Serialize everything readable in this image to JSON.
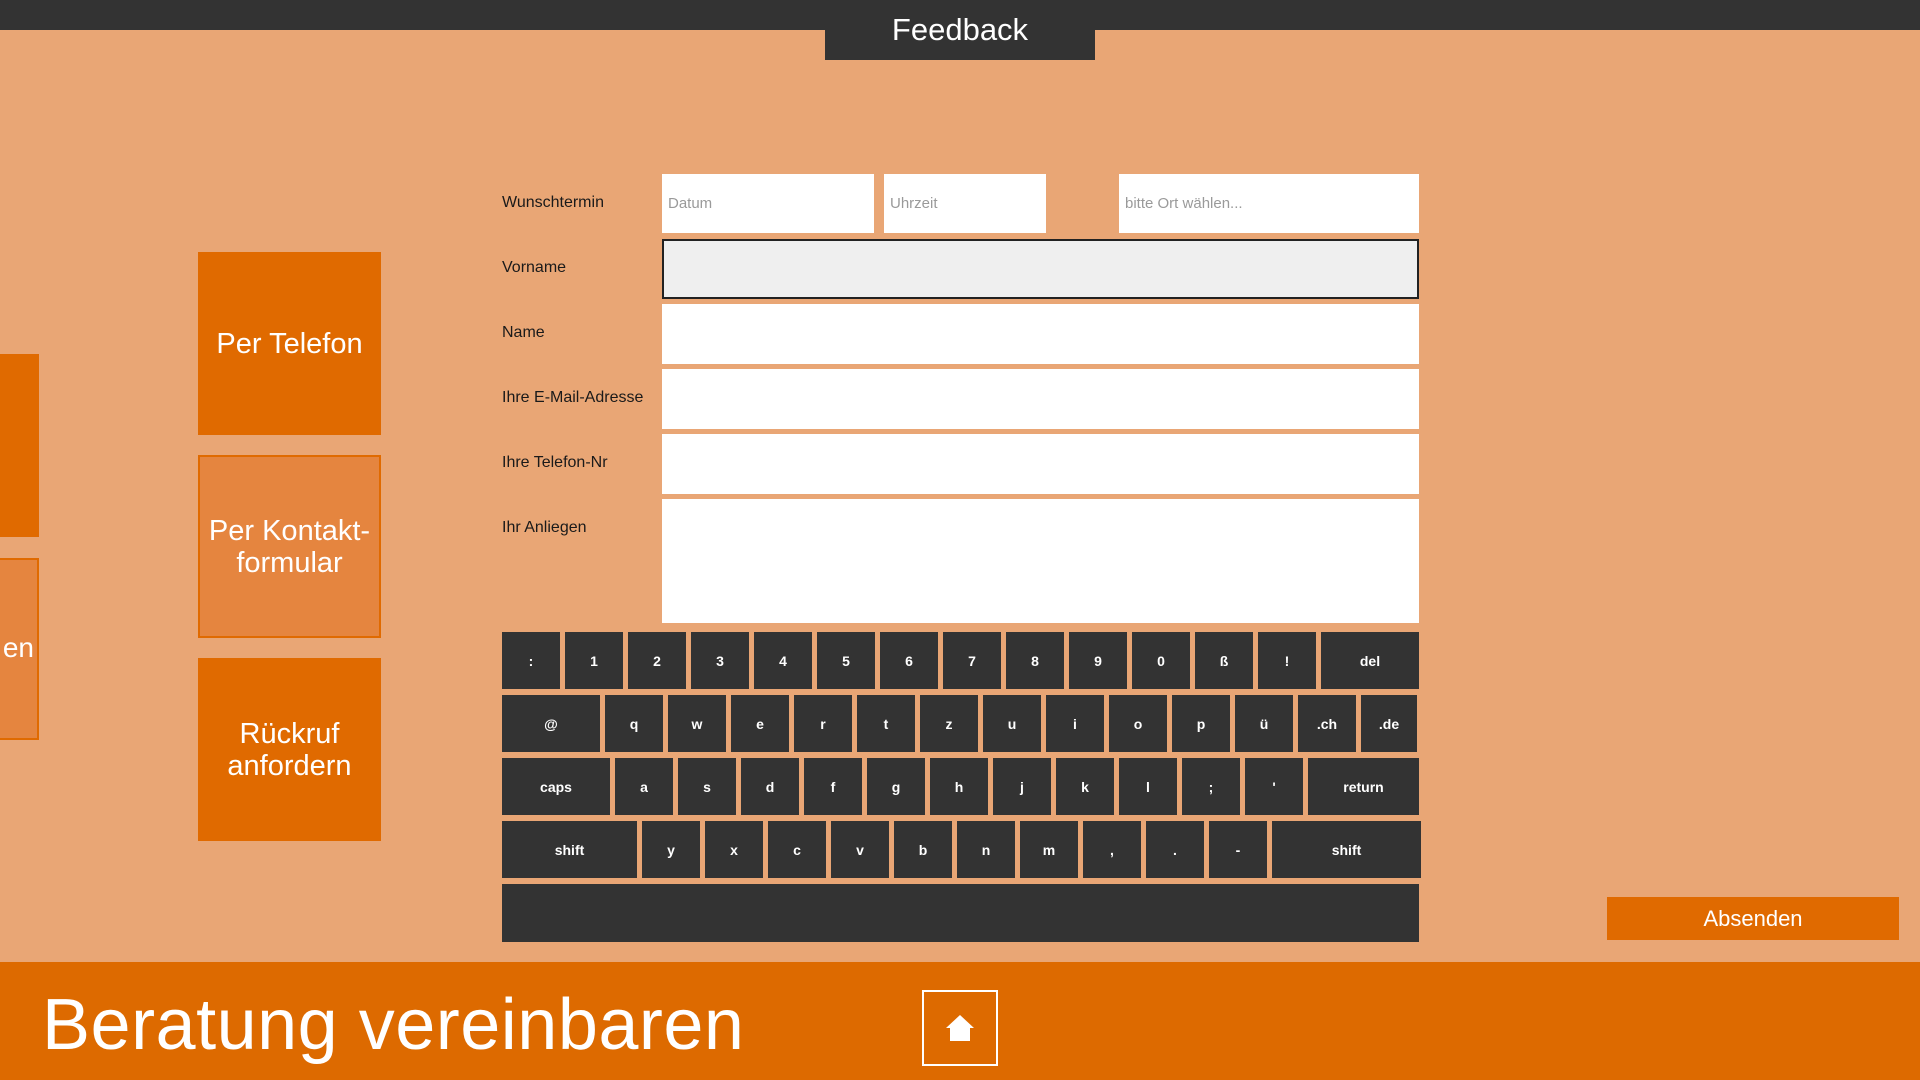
{
  "header": {
    "title": "Feedback"
  },
  "left_edge": {
    "partial_label": "en"
  },
  "options": [
    {
      "label": "Per Telefon"
    },
    {
      "label": "Per Kontakt-\nformular"
    },
    {
      "label": "Rückruf\nanfordern"
    }
  ],
  "form": {
    "wunschtermin_label": "Wunschtermin",
    "datum_placeholder": "Datum",
    "uhrzeit_placeholder": "Uhrzeit",
    "ort_placeholder": "bitte Ort wählen...",
    "vorname_label": "Vorname",
    "name_label": "Name",
    "email_label": "Ihre E-Mail-Adresse",
    "telefon_label": "Ihre Telefon-Nr",
    "anliegen_label": "Ihr Anliegen",
    "submit_label": "Absenden"
  },
  "keyboard": {
    "rows": [
      [
        ":",
        "1",
        "2",
        "3",
        "4",
        "5",
        "6",
        "7",
        "8",
        "9",
        "0",
        "ß",
        "!",
        "del"
      ],
      [
        "@",
        "q",
        "w",
        "e",
        "r",
        "t",
        "z",
        "u",
        "i",
        "o",
        "p",
        "ü",
        ".ch",
        ".de"
      ],
      [
        "caps",
        "a",
        "s",
        "d",
        "f",
        "g",
        "h",
        "j",
        "k",
        "l",
        ";",
        "'",
        "return"
      ],
      [
        "shift",
        "y",
        "x",
        "c",
        "v",
        "b",
        "n",
        "m",
        ",",
        ".",
        "-",
        "shift"
      ]
    ]
  },
  "footer": {
    "title": "Beratung vereinbaren",
    "home_icon": "home-icon"
  },
  "colors": {
    "background": "#E9A675",
    "accent": "#E06A00",
    "dark": "#333333"
  }
}
